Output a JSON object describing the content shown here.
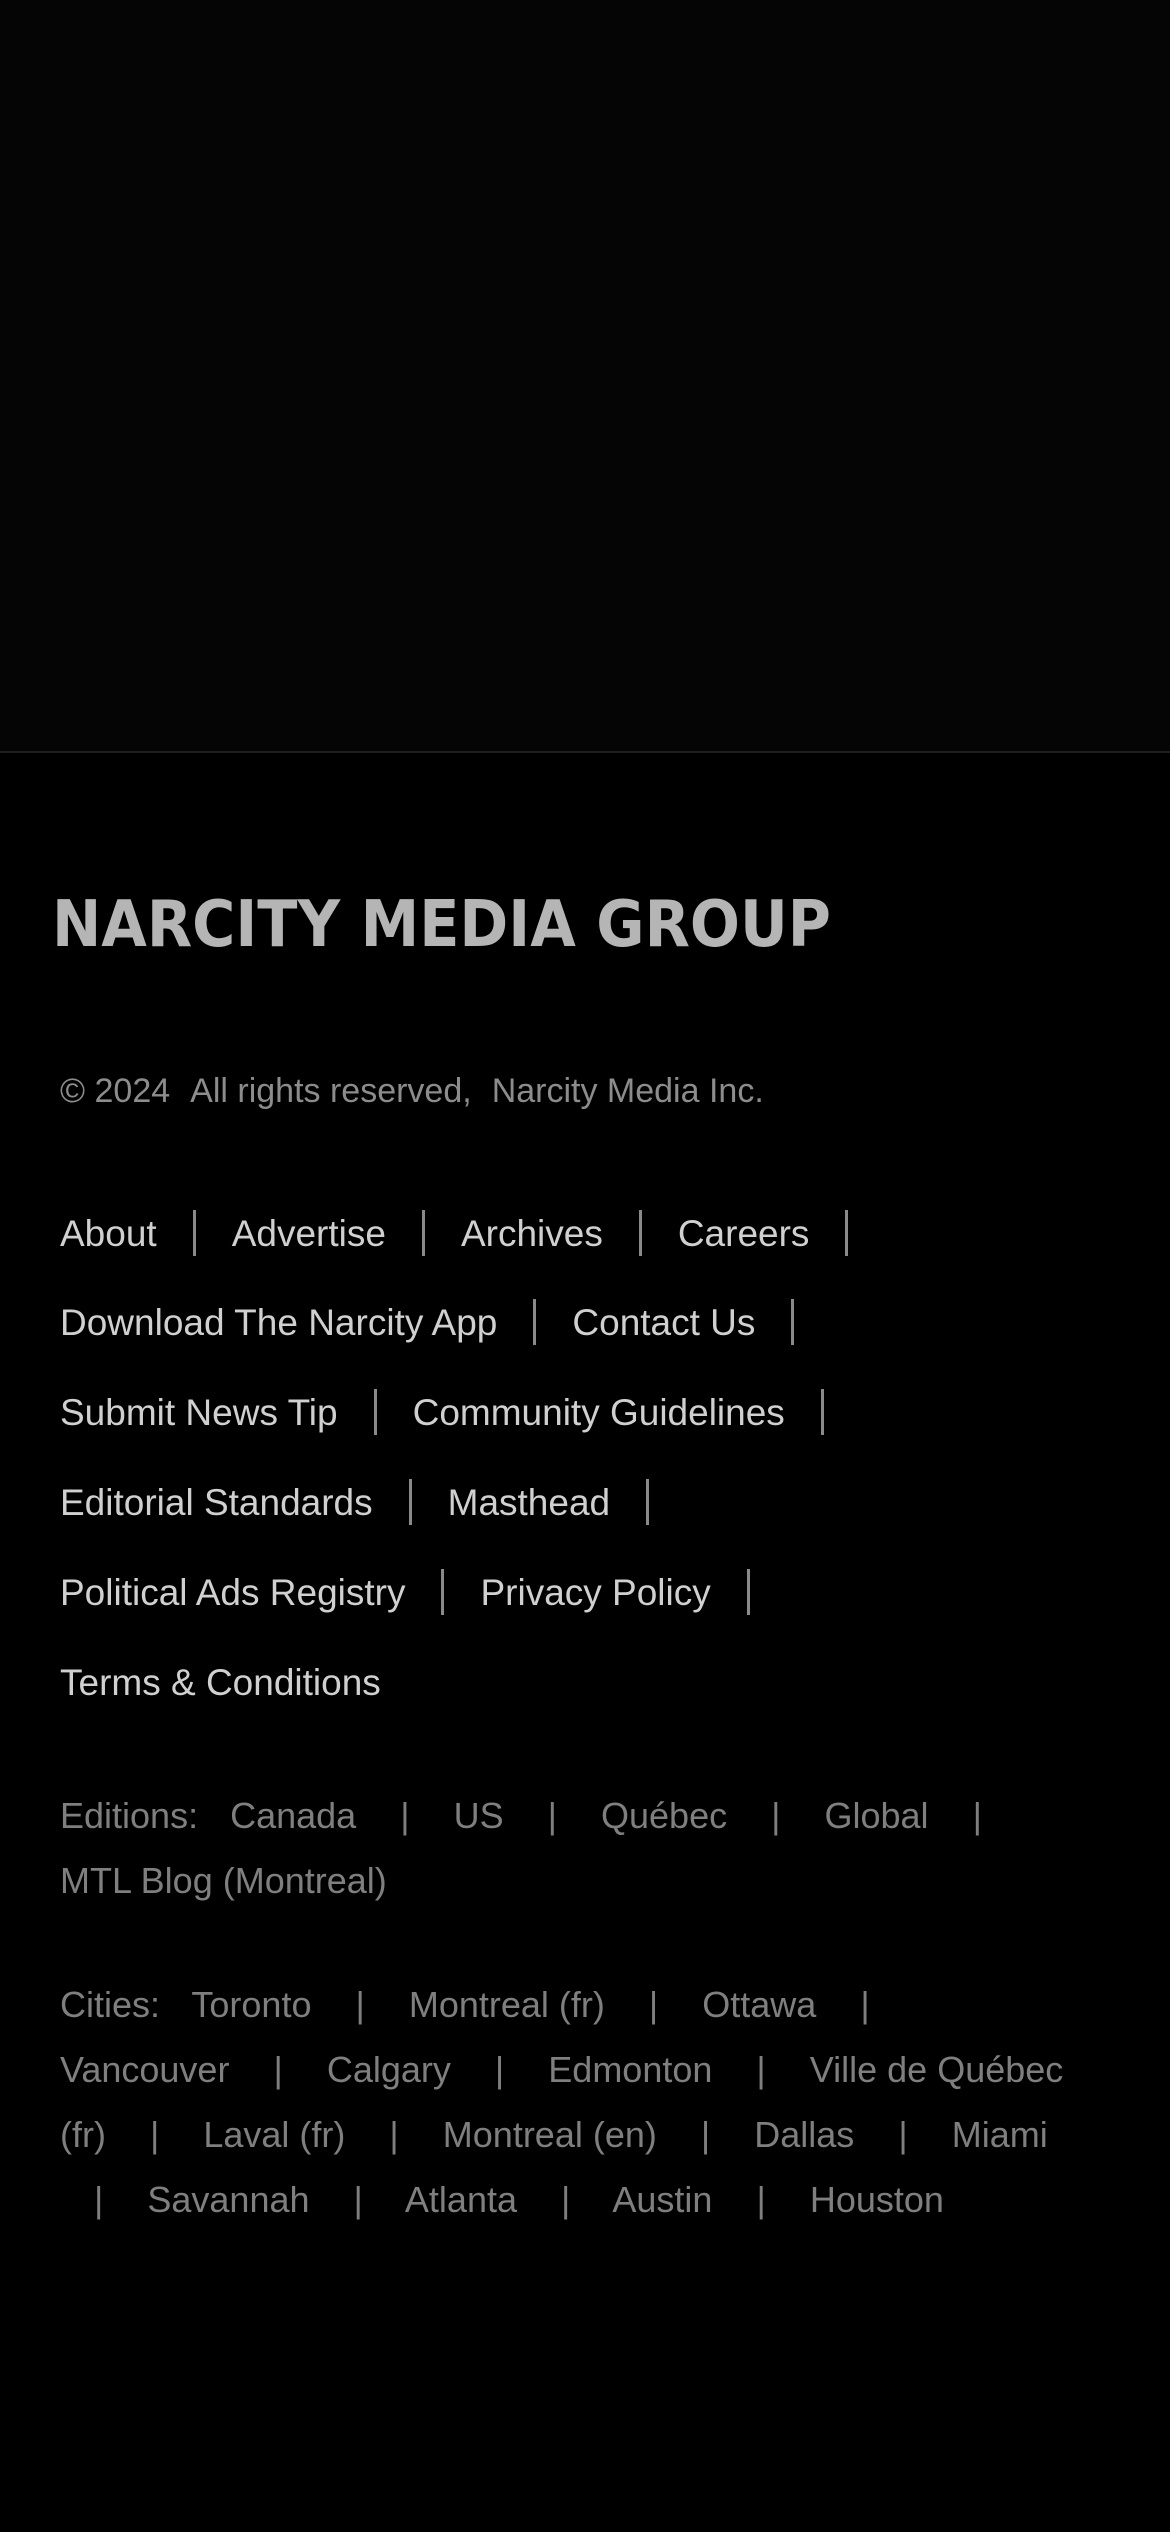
{
  "brand": {
    "logo_text": "NARCITY MEDIA GROUP"
  },
  "copyright": {
    "year": "© 2024",
    "rights": "All rights reserved,",
    "company": "Narcity Media Inc."
  },
  "footer_links": {
    "about": "About",
    "advertise": "Advertise",
    "archives": "Archives",
    "careers": "Careers",
    "download_app": "Download The Narcity App",
    "contact_us": "Contact Us",
    "submit_tip": "Submit News Tip",
    "community_guidelines": "Community Guidelines",
    "editorial_standards": "Editorial Standards",
    "masthead": "Masthead",
    "political_ads": "Political Ads Registry",
    "privacy_policy": "Privacy Policy",
    "terms": "Terms & Conditions"
  },
  "editions": {
    "label": "Editions:",
    "items": [
      "Canada",
      "US",
      "Québec",
      "Global",
      "MTL Blog (Montreal)"
    ]
  },
  "cities": {
    "label": "Cities:",
    "items": [
      "Toronto",
      "Montreal (fr)",
      "Ottawa",
      "Vancouver",
      "Calgary",
      "Edmonton",
      "Ville de Québec (fr)",
      "Laval (fr)",
      "Montreal (en)",
      "Dallas",
      "Miami",
      "Savannah",
      "Atlanta",
      "Austin",
      "Houston"
    ]
  },
  "separator": "|",
  "colors": {
    "background": "#000000",
    "link_text": "#d0d0d0",
    "muted_text": "#7f7f7f",
    "logo": "#b5b5b5"
  }
}
